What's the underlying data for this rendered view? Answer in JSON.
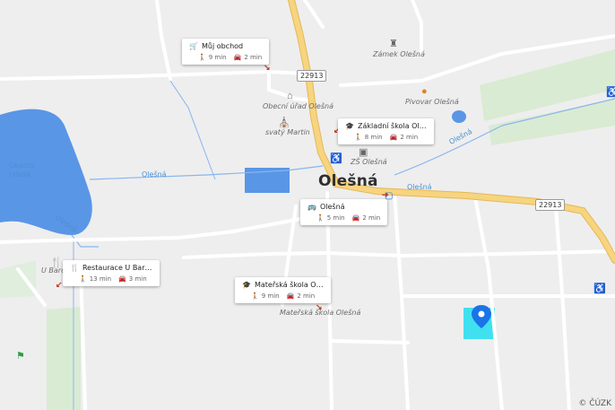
{
  "map": {
    "town_label": "Olešná",
    "copyright": "© ČÚZK",
    "road_shields": [
      "22913",
      "22913"
    ],
    "water_labels": [
      "Obecní rybník",
      "Olešná",
      "Olešná",
      "Olešná",
      "Olešná"
    ],
    "place_labels": [
      "Zámek Olešná",
      "Obecní úřad Olešná",
      "svatý Martin",
      "Pivovar Olešná",
      "ZŠ Olešná",
      "Mateřská škola Olešná",
      "U Barona"
    ],
    "stop_label": "Olešná",
    "colors": {
      "background": "#eeeeee",
      "major_road": "#f7d47e",
      "water": "#5a96e6",
      "green": "#d9ebd3",
      "pin": "#1a73e8",
      "highlight": "#40e0f0"
    }
  },
  "cards": [
    {
      "name": "Můj obchod",
      "icon": "cart-icon",
      "walk": "9 min",
      "drive": "2 min"
    },
    {
      "name": "Základní škola Ol…",
      "icon": "school-icon",
      "walk": "8 min",
      "drive": "2 min"
    },
    {
      "name": "Olešná",
      "icon": "bus-icon",
      "walk": "5 min",
      "drive": "2 min"
    },
    {
      "name": "Restaurace U Bar…",
      "icon": "restaurant-icon",
      "walk": "13 min",
      "drive": "3 min"
    },
    {
      "name": "Mateřská škola O…",
      "icon": "school-icon",
      "walk": "9 min",
      "drive": "2 min"
    }
  ]
}
